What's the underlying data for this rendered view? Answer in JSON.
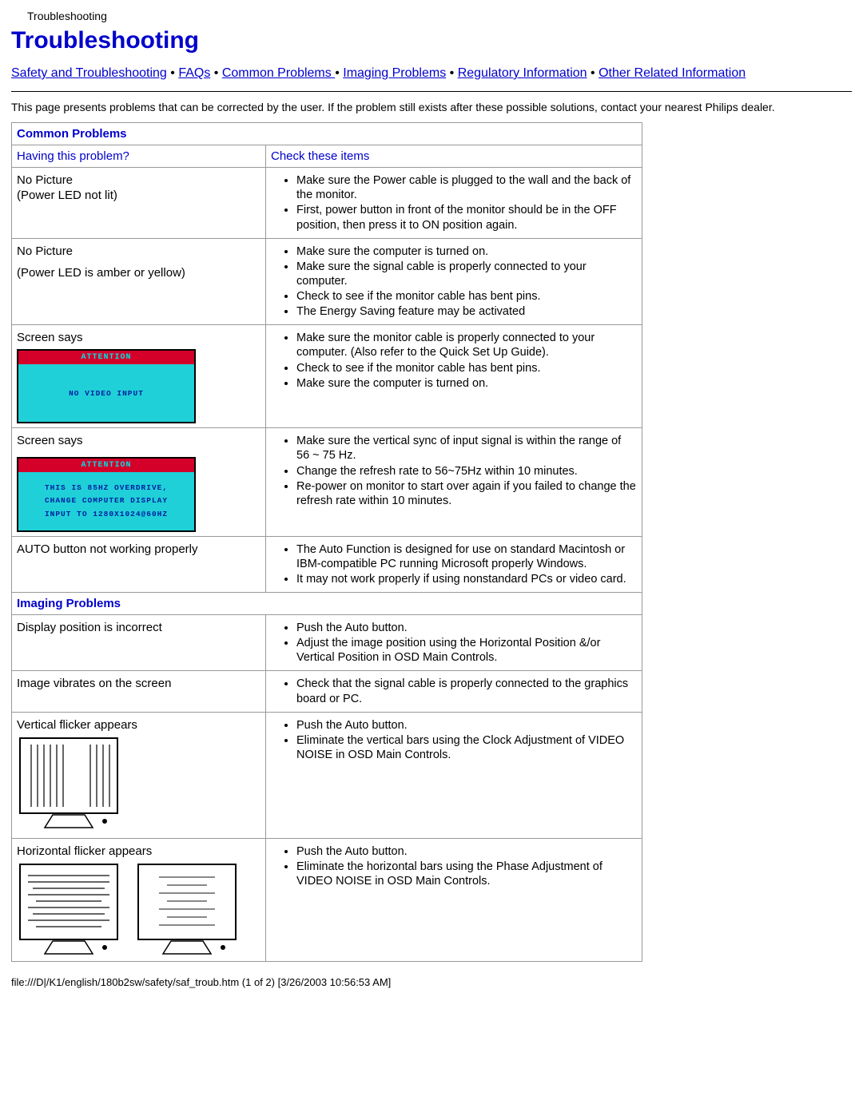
{
  "header_small": "Troubleshooting",
  "page_title": "Troubleshooting",
  "nav": {
    "safety": "Safety and Troubleshooting",
    "faqs": "FAQs",
    "common": "Common Problems ",
    "imaging": "Imaging Problems",
    "regulatory": "Regulatory Information",
    "other": "Other Related Information"
  },
  "intro": "This page presents problems that can be corrected by the user. If the problem still exists after these possible solutions, contact your nearest Philips dealer.",
  "sections": {
    "common_header": "Common Problems",
    "imaging_header": "Imaging Problems",
    "col_problem": "Having this problem?",
    "col_check": "Check these items"
  },
  "rows": {
    "r1_label_a": "No Picture",
    "r1_label_b": "(Power LED not lit)",
    "r1_items": [
      "Make sure the Power cable is plugged to the wall and the back of the monitor.",
      "First, power button in front of the monitor should be in the OFF position, then press it to ON position again."
    ],
    "r2_label_a": "No Picture",
    "r2_label_b": "(Power LED is amber or yellow)",
    "r2_items": [
      "Make sure the computer is turned on.",
      "Make sure the signal cable is properly connected to your computer.",
      "Check to see if the monitor cable has bent pins.",
      "The Energy Saving feature may be activated"
    ],
    "r3_label": "Screen says",
    "r3_osd_attention": "ATTENTION",
    "r3_osd_msg": "NO VIDEO INPUT",
    "r3_items": [
      "Make sure the monitor cable is properly connected to your computer. (Also refer to the Quick Set Up Guide).",
      "Check to see if the monitor cable has bent pins.",
      "Make sure the computer is turned on."
    ],
    "r4_label": "Screen says",
    "r4_osd_attention": "ATTENTION",
    "r4_osd_line1": "THIS IS 85HZ OVERDRIVE,",
    "r4_osd_line2": "CHANGE COMPUTER DISPLAY",
    "r4_osd_line3": "INPUT TO 1280X1024@60HZ",
    "r4_items": [
      "Make sure the vertical sync of input signal is within the range of 56 ~ 75 Hz.",
      "Change the refresh rate to 56~75Hz within 10 minutes.",
      "Re-power on monitor to start over again if you failed to change the refresh rate within 10 minutes."
    ],
    "r5_label": "AUTO button not working properly",
    "r5_items": [
      "The Auto Function is designed for use on standard Macintosh or IBM-compatible PC running Microsoft properly Windows.",
      "It may not work properly if using nonstandard PCs or video card."
    ],
    "r6_label": "Display position is incorrect",
    "r6_items": [
      "Push the Auto button.",
      "Adjust the image position using the Horizontal Position &/or Vertical Position in OSD Main Controls."
    ],
    "r7_label": "Image vibrates on the screen",
    "r7_items": [
      "Check that the signal cable is properly connected to the graphics board or PC."
    ],
    "r8_label": "Vertical flicker appears",
    "r8_items": [
      "Push the Auto button.",
      "Eliminate the vertical bars using the Clock Adjustment of VIDEO NOISE in OSD Main Controls."
    ],
    "r9_label": "Horizontal flicker appears",
    "r9_items": [
      "Push the Auto button.",
      "Eliminate the horizontal bars using the Phase Adjustment of VIDEO NOISE in OSD Main Controls."
    ]
  },
  "footer": "file:///D|/K1/english/180b2sw/safety/saf_troub.htm (1 of 2) [3/26/2003 10:56:53 AM]"
}
